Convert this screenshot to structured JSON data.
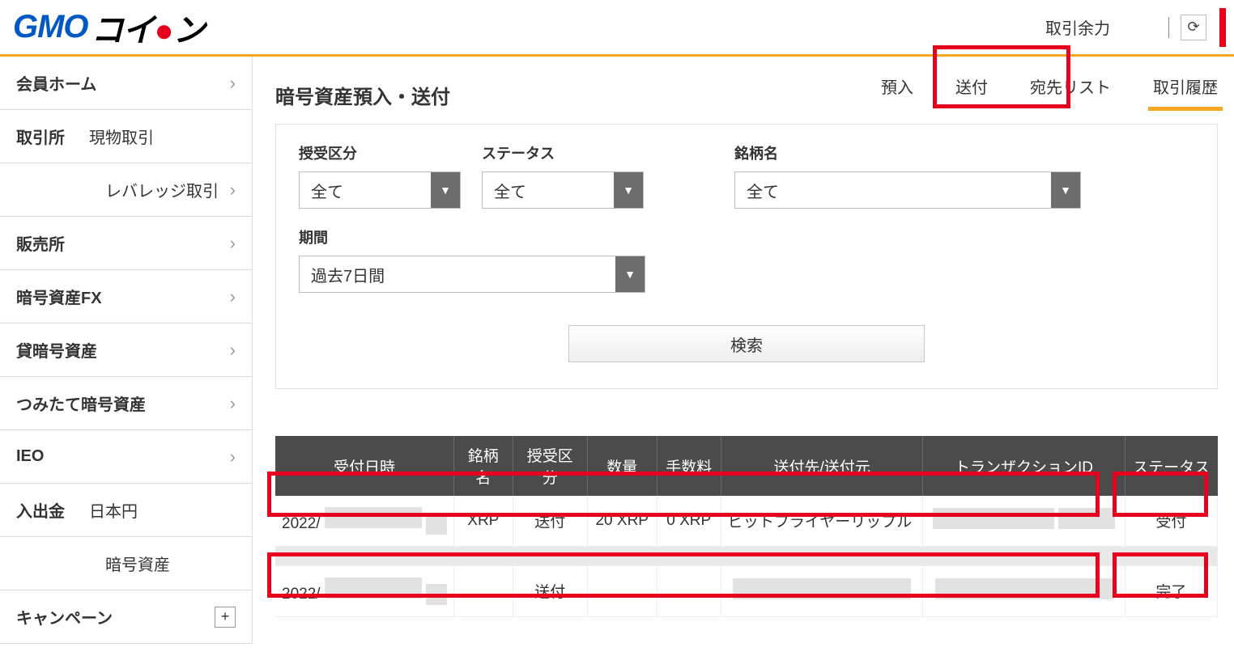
{
  "brand": {
    "gmo": "GMO",
    "coin_prefix": "コイ",
    "coin_suffix": "ン"
  },
  "top": {
    "balance_label": "取引余力"
  },
  "sidebar": {
    "home": "会員ホーム",
    "exchange": "取引所",
    "exchange_sub1": "現物取引",
    "exchange_sub2": "レバレッジ取引",
    "sales": "販売所",
    "fx": "暗号資産FX",
    "lending": "貸暗号資産",
    "tsumitate": "つみたて暗号資産",
    "ieo": "IEO",
    "funds": "入出金",
    "funds_sub1": "日本円",
    "funds_sub2": "暗号資産",
    "campaign": "キャンペーン"
  },
  "content": {
    "title": "暗号資産預入・送付",
    "tabs": {
      "deposit": "預入",
      "send": "送付",
      "dest": "宛先リスト",
      "history": "取引履歴"
    }
  },
  "filters": {
    "type_label": "授受区分",
    "type_value": "全て",
    "status_label": "ステータス",
    "status_value": "全て",
    "symbol_label": "銘柄名",
    "symbol_value": "全て",
    "period_label": "期間",
    "period_value": "過去7日間",
    "search": "検索"
  },
  "table": {
    "headers": [
      "受付日時",
      "銘柄名",
      "授受区分",
      "数量",
      "手数料",
      "送付先/送付元",
      "トランザクションID",
      "ステータス"
    ],
    "rows": [
      {
        "date": "2022/",
        "symbol": "XRP",
        "type": "送付",
        "qty": "20 XRP",
        "fee": "0 XRP",
        "dest": "ビットフライヤーリップル",
        "txid": "",
        "status": "受付"
      },
      {
        "date": "2022/",
        "symbol": "",
        "type": "送付",
        "qty": "",
        "fee": "",
        "dest": "",
        "txid": "",
        "status": "完了"
      }
    ]
  }
}
